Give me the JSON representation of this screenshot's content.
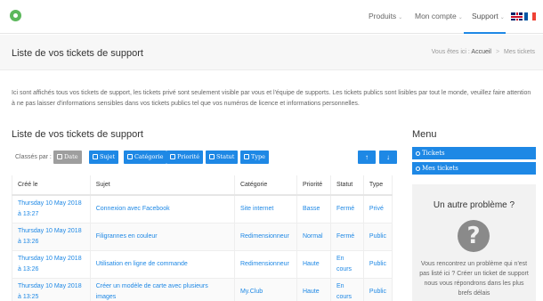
{
  "nav": {
    "items": [
      {
        "label": "Produits",
        "caret": "⌄"
      },
      {
        "label": "Mon compte",
        "caret": "⌄"
      },
      {
        "label": "Support",
        "caret": "⌄"
      }
    ],
    "active_color": "#1e88e5"
  },
  "header": {
    "title": "Liste de vos tickets de support",
    "breadcrumb_prefix": "Vous êtes ici :",
    "breadcrumb_home": "Accueil",
    "breadcrumb_sep": ">",
    "breadcrumb_current": "Mes tickets"
  },
  "intro": "Ici sont affichés tous vos tickets de support, les tickets privé sont seulement visible par vous et l'équipe de supports. Les tickets publics sont lisibles par tout le monde, veuillez faire attention à ne pas laisser d'informations sensibles dans vos tickets publics tel que vos numéros de licence et informations personnelles.",
  "main": {
    "section_title": "Liste de vos tickets de support",
    "sort_label": "Classés par :",
    "sort_buttons": [
      "Date",
      "Sujet",
      "Catégorie",
      "Priorité",
      "Statut",
      "Type"
    ],
    "sort_up": "↑",
    "sort_down": "↓",
    "columns": [
      "Créé le",
      "Sujet",
      "Catégorie",
      "Priorité",
      "Statut",
      "Type"
    ],
    "rows": [
      {
        "date": "Thursday 10 May 2018 à 13:27",
        "subject": "Connexion avec Facebook",
        "category": "Site internet",
        "priority": "Basse",
        "status": "Fermé",
        "type": "Privé"
      },
      {
        "date": "Thursday 10 May 2018 à 13:26",
        "subject": "Filigrannes en couleur",
        "category": "Redimensionneur",
        "priority": "Normal",
        "status": "Fermé",
        "type": "Public"
      },
      {
        "date": "Thursday 10 May 2018 à 13:26",
        "subject": "Utilisation en ligne de commande",
        "category": "Redimensionneur",
        "priority": "Haute",
        "status": "En cours",
        "type": "Public"
      },
      {
        "date": "Thursday 10 May 2018 à 13:25",
        "subject": "Créer un modèle de carte avec plusieurs images",
        "category": "My.Club",
        "priority": "Haute",
        "status": "En cours",
        "type": "Public"
      }
    ]
  },
  "sidebar": {
    "title": "Menu",
    "buttons": [
      "Tickets",
      "Mes tickets"
    ],
    "help_title": "Un autre problème ?",
    "help_icon": "?",
    "help_text": "Vous rencontrez un problème qui n'est pas listé ici ? Créer un ticket de support nous vous répondrons dans les plus brefs délais"
  },
  "colors": {
    "accent": "#1e88e5",
    "logo": "#5cb85c"
  }
}
